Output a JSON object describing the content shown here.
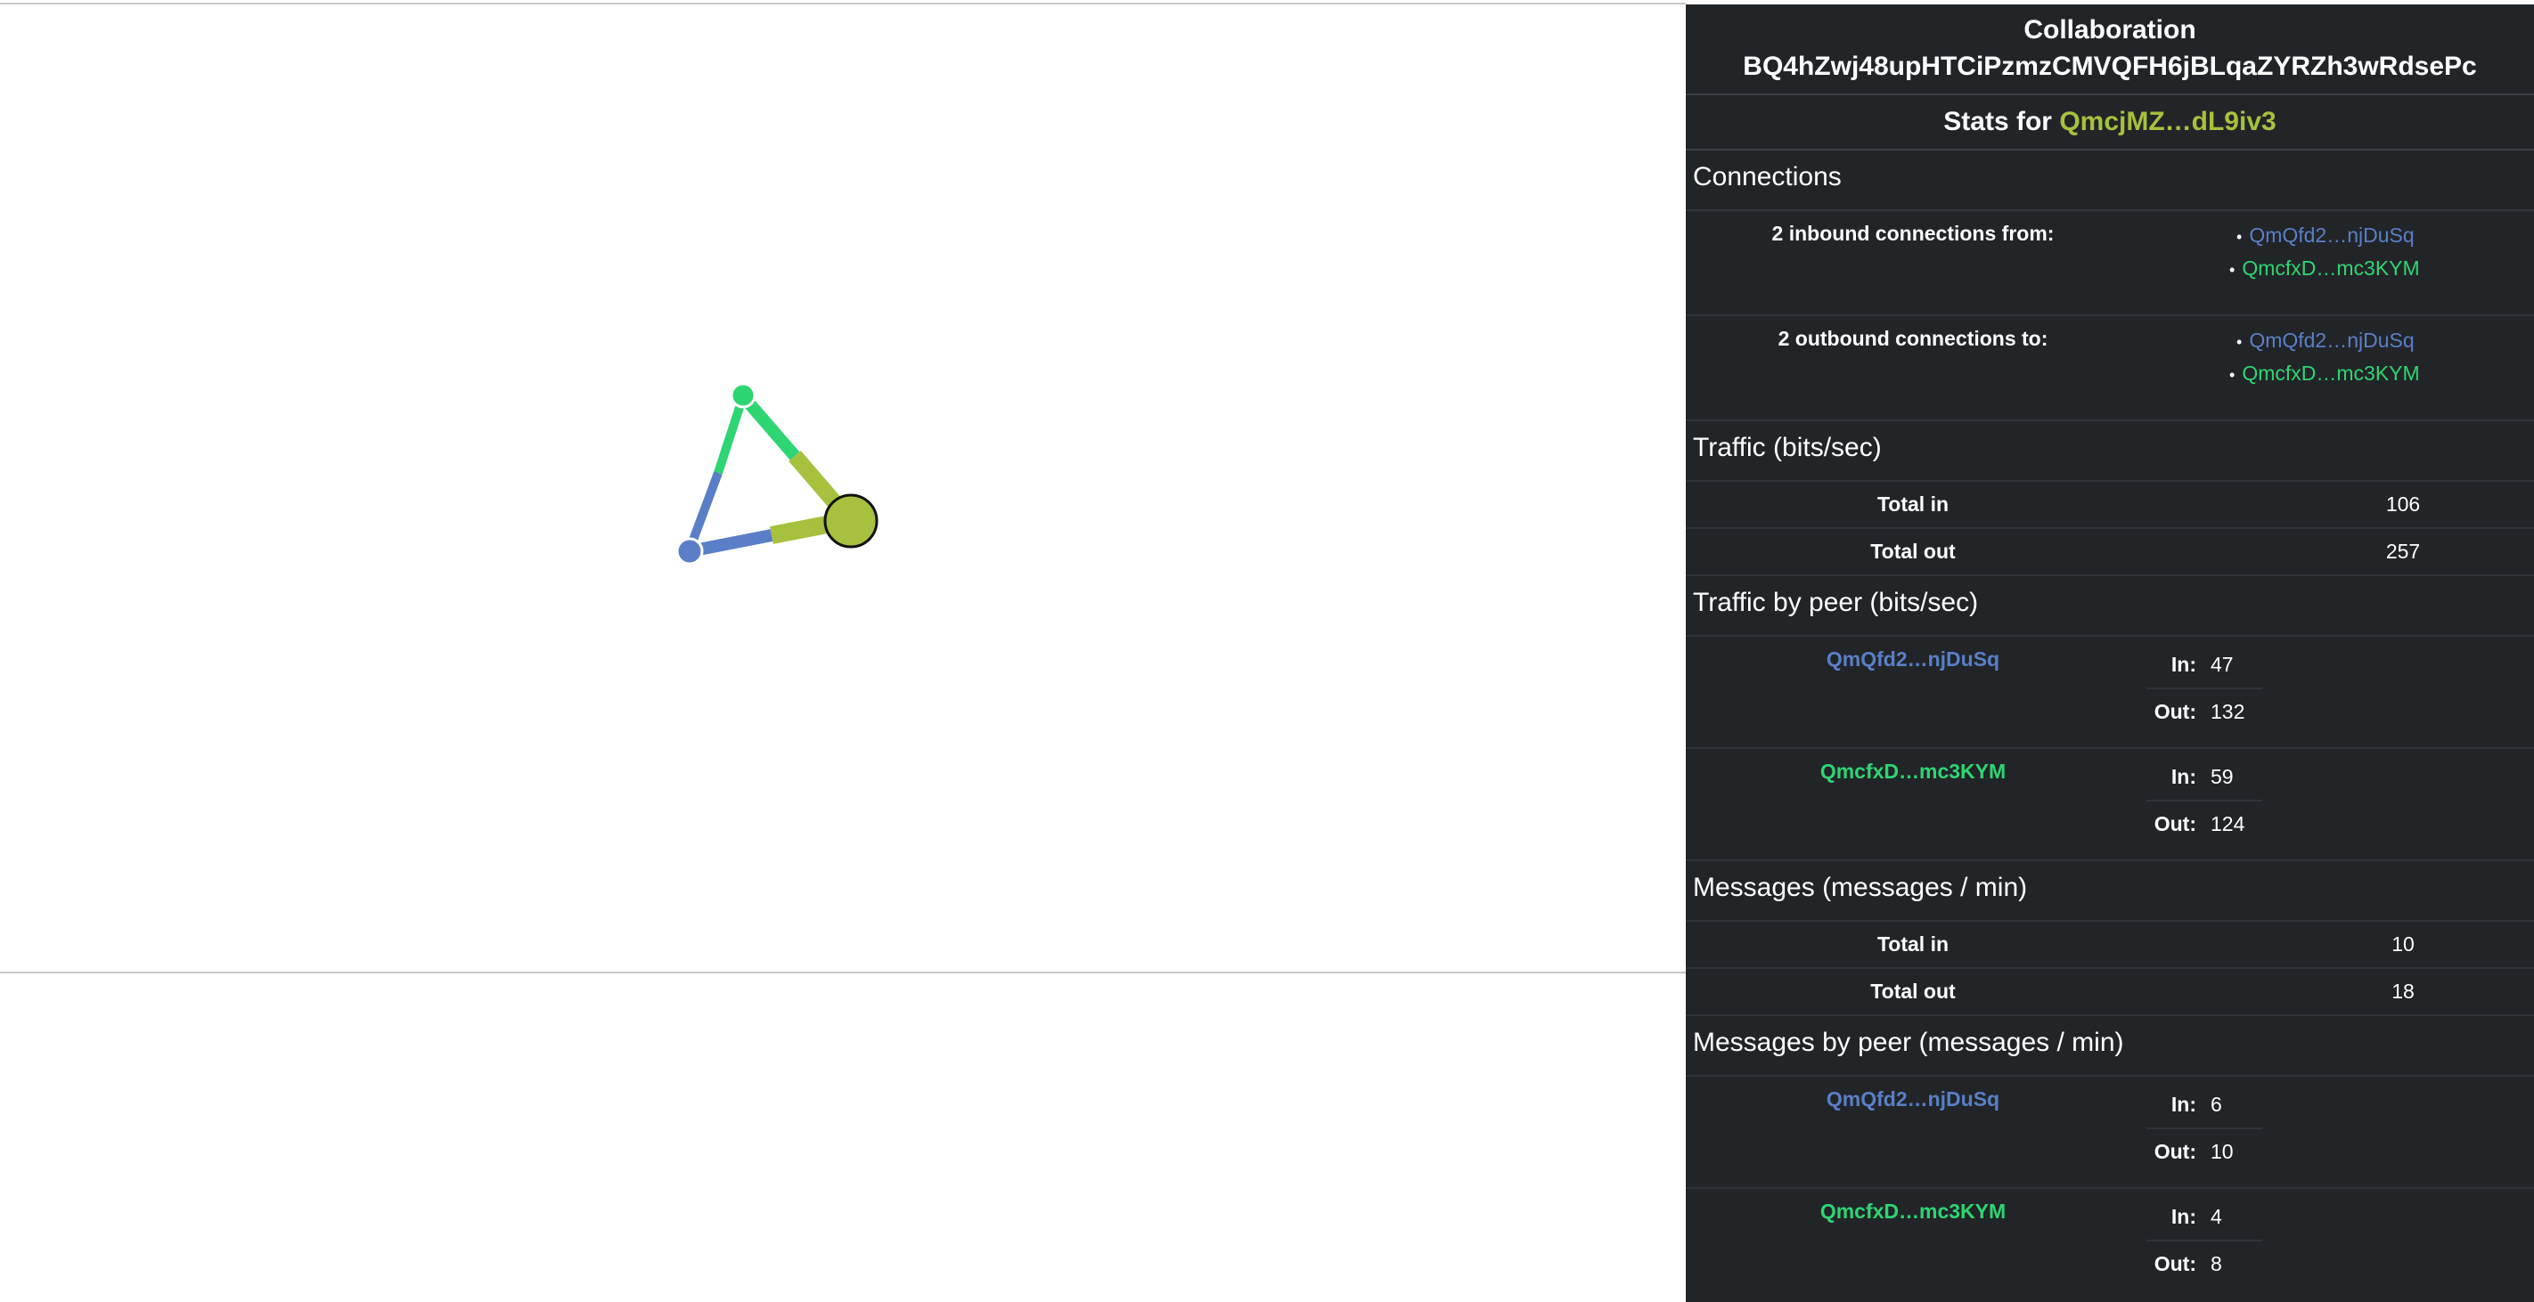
{
  "panel": {
    "collaboration_label": "Collaboration",
    "collaboration_id": "BQ4hZwj48upHTCiPzmzCMVQFH6jBLqaZYRZh3wRdsePc",
    "stats_for_label": "Stats for",
    "stats_for_peer": "QmcjMZ…dL9iv3",
    "connections": {
      "title": "Connections",
      "inbound_label": "2 inbound connections from:",
      "inbound": [
        "QmQfd2…njDuSq",
        "QmcfxD…mc3KYM"
      ],
      "outbound_label": "2 outbound connections to:",
      "outbound": [
        "QmQfd2…njDuSq",
        "QmcfxD…mc3KYM"
      ]
    },
    "traffic": {
      "title": "Traffic (bits/sec)",
      "total_in_label": "Total in",
      "total_in": "106",
      "total_out_label": "Total out",
      "total_out": "257"
    },
    "traffic_by_peer": {
      "title": "Traffic by peer (bits/sec)",
      "peers": [
        {
          "name": "QmQfd2…njDuSq",
          "in_label": "In:",
          "in": "47",
          "out_label": "Out:",
          "out": "132"
        },
        {
          "name": "QmcfxD…mc3KYM",
          "in_label": "In:",
          "in": "59",
          "out_label": "Out:",
          "out": "124"
        }
      ]
    },
    "messages": {
      "title": "Messages (messages / min)",
      "total_in_label": "Total in",
      "total_in": "10",
      "total_out_label": "Total out",
      "total_out": "18"
    },
    "messages_by_peer": {
      "title": "Messages by peer (messages / min)",
      "peers": [
        {
          "name": "QmQfd2…njDuSq",
          "in_label": "In:",
          "in": "6",
          "out_label": "Out:",
          "out": "10"
        },
        {
          "name": "QmcfxD…mc3KYM",
          "in_label": "In:",
          "in": "4",
          "out_label": "Out:",
          "out": "8"
        }
      ]
    }
  },
  "colors": {
    "panel_bg": "#222528",
    "peer_blue": "#5a7fc8",
    "peer_green": "#2ed573",
    "peer_olive": "#a6c13d"
  }
}
